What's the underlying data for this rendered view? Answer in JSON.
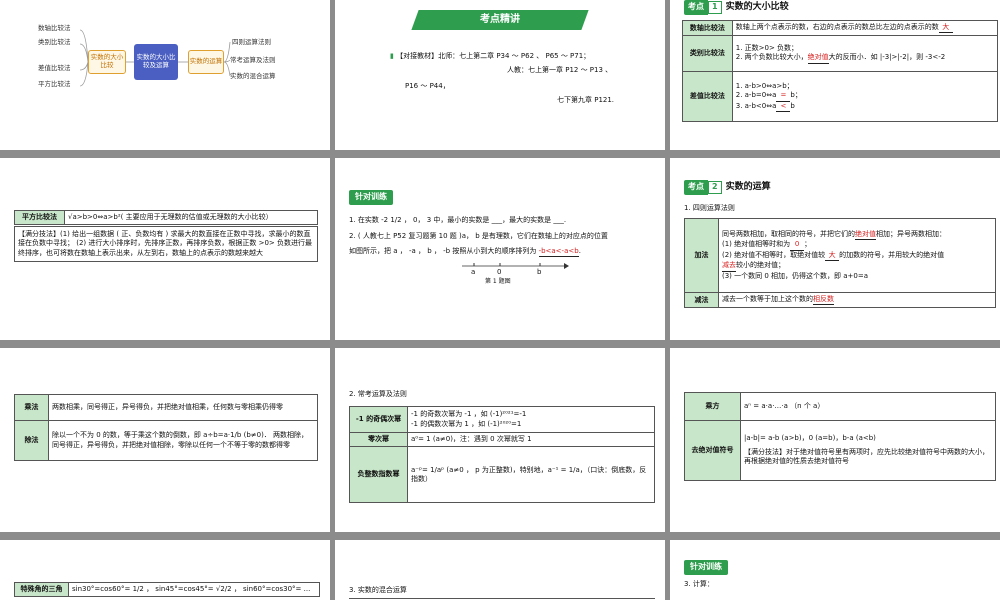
{
  "colors": {
    "accent": "#2e9e4e",
    "highlight": "#d61e1e",
    "cell": "#c8e6c9"
  },
  "s1": {
    "left_nodes": [
      "数轴比较法",
      "类别比较法",
      "差值比较法",
      "平方比较法"
    ],
    "center1": "实数的大小比较",
    "center2": "实数的大小比较及运算",
    "center3": "实数的运算",
    "right_nodes": [
      "四则运算法则",
      "常考运算及法则",
      "实数的混合运算"
    ]
  },
  "s2": {
    "banner": "考点精讲",
    "book_icon": "book-icon",
    "line1": "【对接教材】北师：七上第二章 P34 ～ P62 、 P65 ～ P71；",
    "line2": "人教：七上第一章 P12 ～ P13 、",
    "line3": "P16 ～ P44，",
    "line4": "七下第九章 P121."
  },
  "s3": {
    "tag": "考点",
    "num": "1",
    "title": "实数的大小比较",
    "r1_head": "数轴比较法",
    "r1_text": "数轴上两个点表示的数，右边的点表示的数总比左边的点表示的数",
    "r1_ans": "大",
    "r2_head": "类别比较法",
    "r2_l1": "1. 正数>0> 负数；",
    "r2_l2a": "2. 两个负数比较大小，",
    "r2_ans": "绝对值",
    "r2_l2b": "大的反而小．如 |-3|>|-2|，则 -3<-2",
    "r3_head": "差值比较法",
    "r3_l1a": "1. a-b>0⇔a>b；",
    "r3_l2a": "2. a-b=0⇔a",
    "r3_l2ans": "=",
    "r3_l2b": "b；",
    "r3_l3a": "3. a-b<0⇔a",
    "r3_l3ans": "<",
    "r3_l3b": "b"
  },
  "s4": {
    "head": "平方比较法",
    "text": "√a>b>0⇔a>b²( 主要应用于无理数的估值或无理数的大小比较）",
    "tip": "【满分技法】(1) 给出一组数据 ( 正、负数均有 ) 求最大的数直接在正数中寻找，求最小的数直接在负数中寻找； (2) 进行大小排序时，先排序正数，再排序负数，根据正数 >0> 负数进行最终排序，也可将数在数轴上表示出来，从左到右，数轴上的点表示的数越来越大"
  },
  "s5": {
    "train": "针对训练",
    "q1": "1. 在实数 -2 1/2 ， 0， 3 中，最小的实数是 ___，最大的实数是 ___.",
    "q2a": "2. ( 人教七上 P52 复习题第 10 题 )a， b 是有理数，它们在数轴上的对应点的位置",
    "q2b": "如图所示，把 a ， -a ， b ， -b 按照从小到大的顺序排列为",
    "q2ans": "-b<a<-a<b",
    "axis_a": "a",
    "axis_0": "0",
    "axis_b": "b",
    "caption": "第 1 题图"
  },
  "s6": {
    "tag": "考点",
    "num": "2",
    "title": "实数的运算",
    "sub": "1. 四则运算法则",
    "add_head": "加法",
    "add_l1a": "同号两数相加，取相同的符号，并把它们的",
    "add_ans1": "绝对值",
    "add_l1b": "相加；异号两数相加：",
    "add_l2a": "(1) 绝对值相等时和为",
    "add_ans2": "0",
    "add_l2b": "；",
    "add_l3a": "(2) 绝对值不相等时，取绝对值较",
    "add_ans3": "大",
    "add_l3b": "的加数的符号，并用较大的绝对值",
    "add_ans4": "减去",
    "add_l4b": "较小的绝对值；",
    "add_l5": "(3) 一个数同 0 相加，仍得这个数，即 a+0=a",
    "sub_head": "减法",
    "sub_text": "减去一个数等于加上这个数的",
    "sub_ans": "相反数"
  },
  "s7": {
    "mul_head": "乘法",
    "mul_text": "两数相乘，同号得正，异号得负，并把绝对值相乘，任何数与零相乘仍得零",
    "div_head": "除法",
    "div_text": "除以一个不为 0 的数，等于乘这个数的倒数，即 a÷b=a·1/b (b≠0)． 两数相除，同号得正，异号得负，并把绝对值相除，零除以任何一个不等于零的数都得零"
  },
  "s8": {
    "sub": "2. 常考运算及法则",
    "odd_head": "-1 的奇偶次幂",
    "odd_l1": "-1 的奇数次幂为 -1 ，如 (-1)²⁰²¹=-1",
    "odd_l2": "-1 的偶数次幂为 1 ，如 (-1)²⁰²⁰=1",
    "zero_head": "零次幂",
    "zero_text": "a⁰=  1  (a≠0)，注：遇到 0 次幂就写 1",
    "neg_head": "负整数指数幂",
    "neg_text": "a⁻ᵖ= 1/aᵖ (a≠0 ， p 为正整数)，特别地，a⁻¹ = 1/a，（口诀：倒底数，反指数）"
  },
  "s9": {
    "pow_head": "乘方",
    "pow_text": "aⁿ = a·a·…·a （n 个 a）",
    "abs_head": "去绝对值符号",
    "abs_text": "|a-b|= a-b (a>b)，0 (a=b)，b-a (a<b)",
    "tip": "【满分技法】对于绝对值符号里有两项时，应先比较绝对值符号中两数的大小，再根据绝对值的性质去绝对值符号"
  },
  "s10": {
    "head": "特殊角的三角",
    "text": "sin30°=cos60°= 1/2 ， sin45°=cos45°= √2/2 ， sin60°=cos30°= ..."
  },
  "s11": {
    "sub": "3. 实数的混合运算"
  },
  "s12": {
    "train": "针对训练",
    "q3": "3. 计算："
  }
}
